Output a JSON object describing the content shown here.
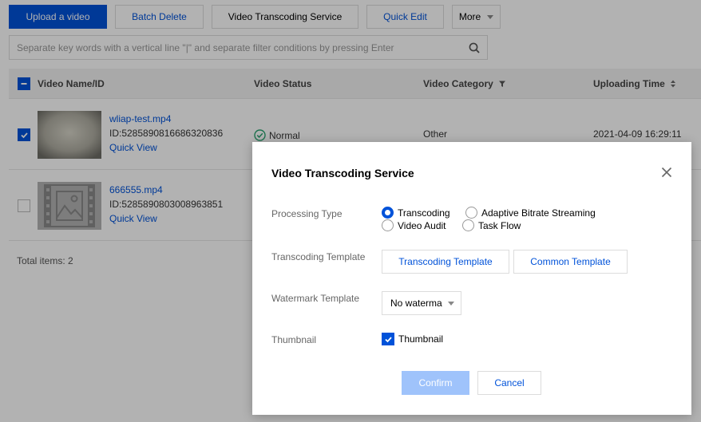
{
  "toolbar": {
    "upload_label": "Upload a video",
    "batch_delete_label": "Batch Delete",
    "transcoding_label": "Video Transcoding Service",
    "quick_edit_label": "Quick Edit",
    "more_label": "More"
  },
  "search": {
    "placeholder": "Separate key words with a vertical line \"|\" and separate filter conditions by pressing Enter"
  },
  "table": {
    "headers": {
      "name": "Video Name/ID",
      "status": "Video Status",
      "category": "Video Category",
      "time": "Uploading Time"
    },
    "rows": [
      {
        "name": "wliap-test.mp4",
        "id": "ID:5285890816686320836",
        "quick_view": "Quick View",
        "status": "Normal",
        "category": "Other",
        "time": "2021-04-09 16:29:11",
        "checked": true
      },
      {
        "name": "666555.mp4",
        "id": "ID:5285890803008963851",
        "quick_view": "Quick View",
        "checked": false
      }
    ],
    "total": "Total items:  2"
  },
  "dialog": {
    "title": "Video Transcoding Service",
    "processing_type_label": "Processing Type",
    "options": {
      "transcoding": "Transcoding",
      "abs": "Adaptive Bitrate Streaming",
      "audit": "Video Audit",
      "task_flow": "Task Flow"
    },
    "selected_option": "transcoding",
    "transcoding_template_label": "Transcoding Template",
    "template_buttons": {
      "transcoding": "Transcoding Template",
      "common": "Common Template"
    },
    "watermark_label": "Watermark Template",
    "watermark_value": "No waterma",
    "thumbnail_label": "Thumbnail",
    "thumbnail_check_label": "Thumbnail",
    "thumbnail_checked": true,
    "confirm_label": "Confirm",
    "cancel_label": "Cancel"
  },
  "colors": {
    "primary": "#0052d9",
    "confirm_disabled": "#9fc3fb",
    "status_ok": "#2ba471"
  }
}
